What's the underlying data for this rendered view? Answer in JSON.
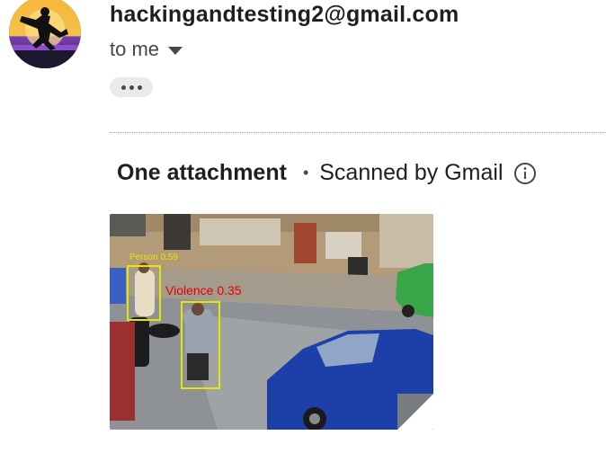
{
  "email": {
    "sender": "hackingandtesting2@gmail.com",
    "recipient_line": "to me"
  },
  "attachments": {
    "title": "One attachment",
    "separator": "•",
    "scan_note": "Scanned by Gmail"
  },
  "thumbnail": {
    "detections": [
      {
        "label": "Person 0.59",
        "color": "#e6e600"
      },
      {
        "label": "Violence 0.35",
        "color": "#e60000"
      }
    ]
  },
  "icons": {
    "caret": "chevron-down-icon",
    "more": "more-horiz-icon",
    "info": "info-icon"
  },
  "colors": {
    "text_primary": "#1f1f1f",
    "text_secondary": "#444746",
    "chip_bg": "#e8eaed",
    "box_yellow": "#e6e600",
    "box_red": "#e60000"
  }
}
